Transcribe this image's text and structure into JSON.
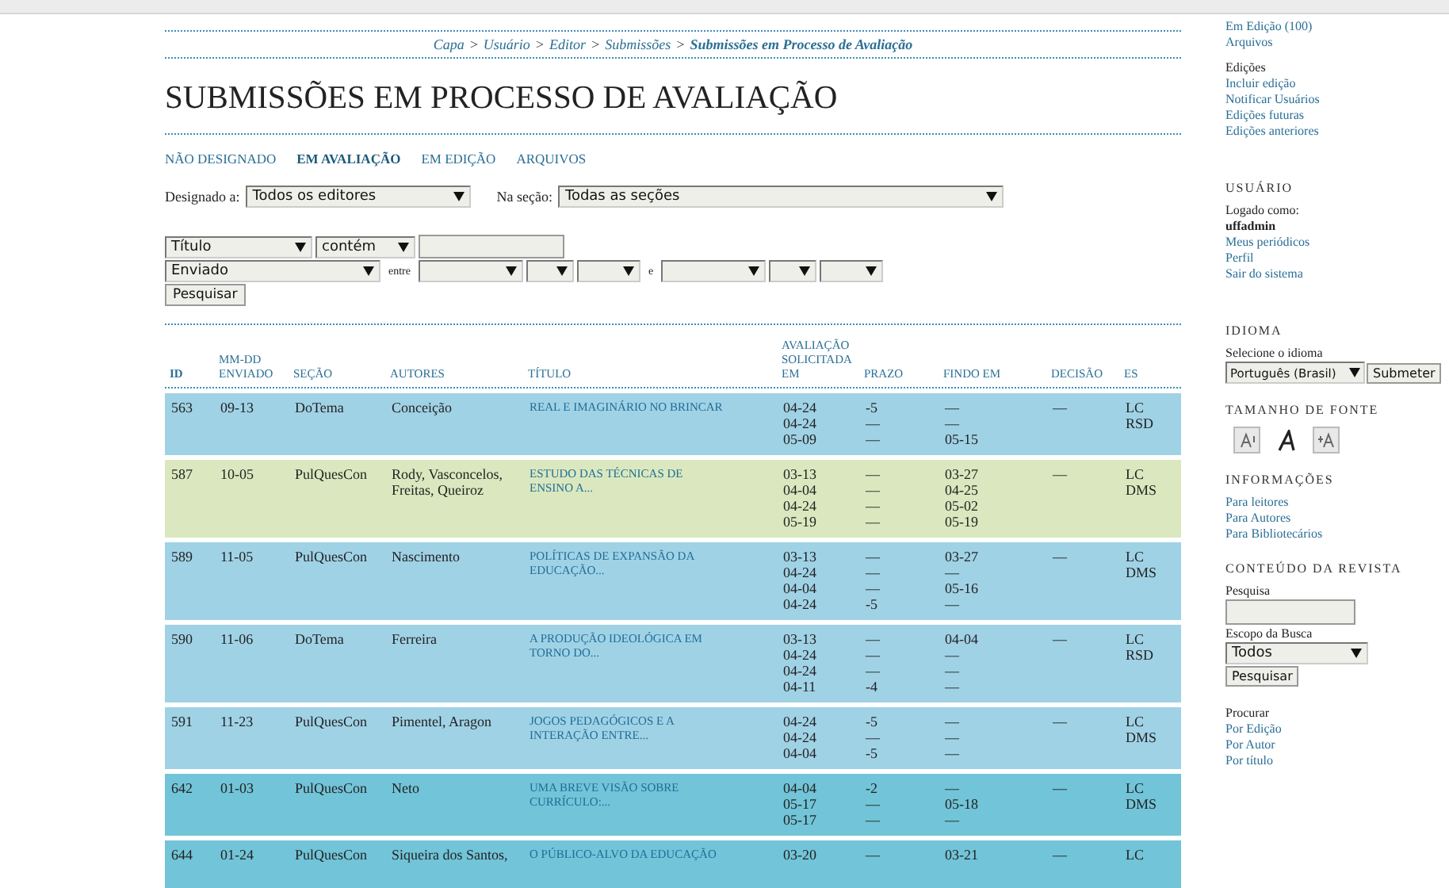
{
  "breadcrumb": [
    {
      "label": "Capa",
      "current": false
    },
    {
      "label": "Usuário",
      "current": false
    },
    {
      "label": "Editor",
      "current": false
    },
    {
      "label": "Submissões",
      "current": false
    },
    {
      "label": "Submissões em Processo de Avaliação",
      "current": true
    }
  ],
  "breadcrumb_separator": ">",
  "title": "SUBMISSÕES EM PROCESSO DE AVALIAÇÃO",
  "tabs": [
    {
      "label": "NÃO DESIGNADO",
      "selected": false
    },
    {
      "label": "EM AVALIAÇÃO",
      "selected": true
    },
    {
      "label": "EM EDIÇÃO",
      "selected": false
    },
    {
      "label": "ARQUIVOS",
      "selected": false
    }
  ],
  "filters": {
    "assigned_label": "Designado a:",
    "assigned_value": "Todos os editores",
    "section_label": "Na seção:",
    "section_value": "Todas as seções",
    "field_value": "Título",
    "match_value": "contém",
    "date_field_value": "Enviado",
    "between_label": "entre",
    "and_label": "e",
    "search_button": "Pesquisar"
  },
  "table": {
    "columns": [
      {
        "label": "ID"
      },
      {
        "label": "ENVIADO",
        "sub": "MM-DD"
      },
      {
        "label": "SEÇÃO"
      },
      {
        "label": "AUTORES"
      },
      {
        "label": "TÍTULO"
      },
      {
        "label": "AVALIAÇÃO SOLICITADA EM"
      },
      {
        "label": "PRAZO"
      },
      {
        "label": "FINDO EM"
      },
      {
        "label": "DECISÃO"
      },
      {
        "label": "ES"
      }
    ],
    "rows": [
      {
        "id": "563",
        "submitted": "09-13",
        "section": "DoTema",
        "authors": "Conceição",
        "title": "REAL E IMAGINÁRIO NO BRINCAR",
        "color": "#a0d2e6",
        "requested": [
          "04-24",
          "04-24",
          "05-09"
        ],
        "due": [
          "-5",
          "—",
          "—"
        ],
        "done": [
          "—",
          "—",
          "05-15"
        ],
        "decision": "—",
        "editors": [
          "LC",
          "RSD"
        ]
      },
      {
        "id": "587",
        "submitted": "10-05",
        "section": "PulQuesCon",
        "authors": "Rody, Vasconcelos, Freitas, Queiroz",
        "title": "ESTUDO DAS TÉCNICAS DE ENSINO A...",
        "color": "#dbe8bf",
        "requested": [
          "03-13",
          "04-04",
          "04-24",
          "05-19"
        ],
        "due": [
          "—",
          "—",
          "—",
          "—"
        ],
        "done": [
          "03-27",
          "04-25",
          "05-02",
          "05-19"
        ],
        "decision": "—",
        "editors": [
          "LC",
          "DMS"
        ]
      },
      {
        "id": "589",
        "submitted": "11-05",
        "section": "PulQuesCon",
        "authors": "Nascimento",
        "title": "POLÍTICAS DE EXPANSÃO DA EDUCAÇÃO...",
        "color": "#a0d2e6",
        "requested": [
          "03-13",
          "04-24",
          "04-04",
          "04-24"
        ],
        "due": [
          "—",
          "—",
          "—",
          "-5"
        ],
        "done": [
          "03-27",
          "—",
          "05-16",
          "—"
        ],
        "decision": "—",
        "editors": [
          "LC",
          "DMS"
        ]
      },
      {
        "id": "590",
        "submitted": "11-06",
        "section": "DoTema",
        "authors": "Ferreira",
        "title": "A PRODUÇÃO IDEOLÓGICA EM TORNO DO...",
        "color": "#a0d2e6",
        "requested": [
          "03-13",
          "04-24",
          "04-24",
          "04-11"
        ],
        "due": [
          "—",
          "—",
          "—",
          "-4"
        ],
        "done": [
          "04-04",
          "—",
          "—",
          "—"
        ],
        "decision": "—",
        "editors": [
          "LC",
          "RSD"
        ]
      },
      {
        "id": "591",
        "submitted": "11-23",
        "section": "PulQuesCon",
        "authors": "Pimentel, Aragon",
        "title": "JOGOS PEDAGÓGICOS E A INTERAÇÃO ENTRE...",
        "color": "#a0d2e6",
        "requested": [
          "04-24",
          "04-24",
          "04-04"
        ],
        "due": [
          "-5",
          "—",
          "-5"
        ],
        "done": [
          "—",
          "—",
          "—"
        ],
        "decision": "—",
        "editors": [
          "LC",
          "DMS"
        ]
      },
      {
        "id": "642",
        "submitted": "01-03",
        "section": "PulQuesCon",
        "authors": "Neto",
        "title": "UMA BREVE VISÃO SOBRE CURRÍCULO:...",
        "color": "#72c4d8",
        "requested": [
          "04-04",
          "05-17",
          "05-17"
        ],
        "due": [
          "-2",
          "—",
          "—"
        ],
        "done": [
          "—",
          "05-18",
          "—"
        ],
        "decision": "—",
        "editors": [
          "LC",
          "DMS"
        ]
      },
      {
        "id": "644",
        "submitted": "01-24",
        "section": "PulQuesCon",
        "authors": "Siqueira dos Santos,",
        "title": "O PÚBLICO-ALVO DA EDUCAÇÃO",
        "color": "#72c4d8",
        "requested": [
          "03-20"
        ],
        "due": [
          "—"
        ],
        "done": [
          "03-21"
        ],
        "decision": "—",
        "editors": [
          "LC"
        ]
      }
    ]
  },
  "sidebar": [
    {
      "items": [
        {
          "kind": "link",
          "text": "Em Edição (100)"
        },
        {
          "kind": "link",
          "text": "Arquivos"
        }
      ]
    },
    {
      "items": [
        {
          "kind": "label",
          "text": "Edições"
        },
        {
          "kind": "link",
          "text": "Incluir edição"
        },
        {
          "kind": "link",
          "text": "Notificar Usuários"
        },
        {
          "kind": "link",
          "text": "Edições futuras"
        },
        {
          "kind": "link",
          "text": "Edições anteriores"
        }
      ]
    },
    {
      "heading": "USUÁRIO",
      "items": [
        {
          "kind": "label",
          "text": "Logado como:"
        },
        {
          "kind": "bold",
          "text": "uffadmin"
        },
        {
          "kind": "link",
          "text": "Meus periódicos"
        },
        {
          "kind": "link",
          "text": "Perfil"
        },
        {
          "kind": "link",
          "text": "Sair do sistema"
        }
      ]
    },
    {
      "heading": "IDIOMA",
      "items": [
        {
          "kind": "label",
          "text": "Selecione o idioma"
        },
        {
          "kind": "langselect",
          "text": "Português (Brasil)",
          "button": "Submeter"
        }
      ]
    },
    {
      "heading": "TAMANHO DE FONTE",
      "items": [
        {
          "kind": "fontsizes"
        }
      ]
    },
    {
      "heading": "INFORMAÇÕES",
      "items": [
        {
          "kind": "link",
          "text": "Para leitores"
        },
        {
          "kind": "link",
          "text": "Para Autores"
        },
        {
          "kind": "link",
          "text": "Para Bibliotecários"
        }
      ]
    },
    {
      "heading": "CONTEÚDO DA REVISTA",
      "items": [
        {
          "kind": "label",
          "text": "Pesquisa"
        },
        {
          "kind": "input"
        },
        {
          "kind": "label",
          "text": "Escopo da Busca"
        },
        {
          "kind": "select",
          "text": "Todos"
        },
        {
          "kind": "button",
          "text": "Pesquisar"
        }
      ]
    },
    {
      "items": [
        {
          "kind": "label",
          "text": "Procurar"
        },
        {
          "kind": "link",
          "text": "Por Edição"
        },
        {
          "kind": "link",
          "text": "Por Autor"
        },
        {
          "kind": "link",
          "text": "Por título"
        }
      ]
    }
  ]
}
